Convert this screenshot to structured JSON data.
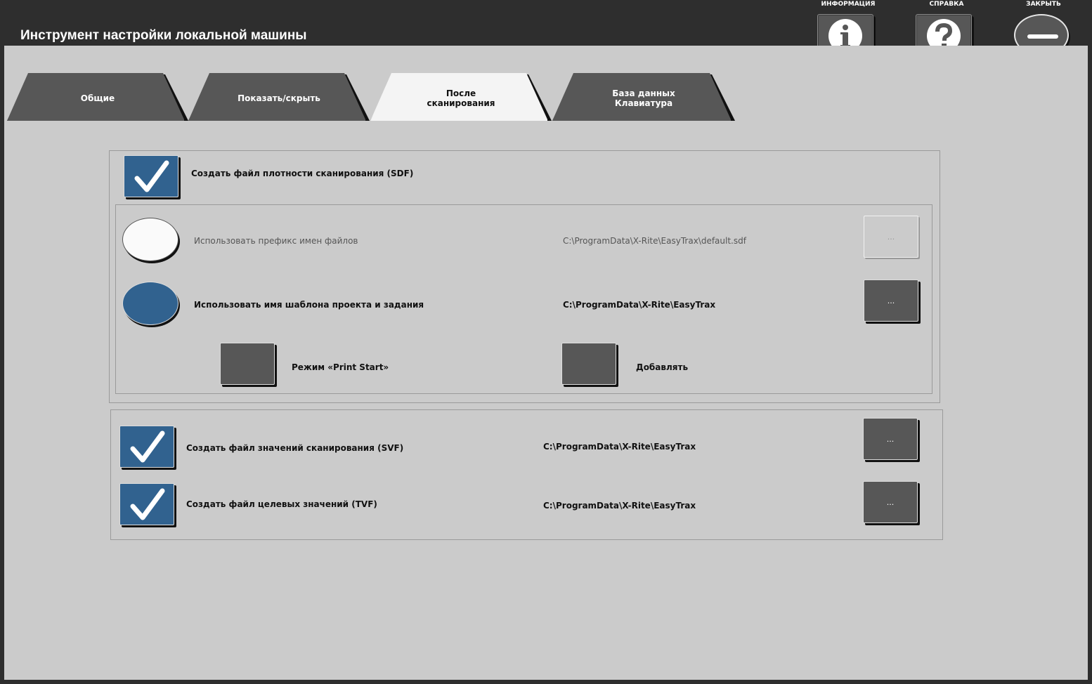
{
  "header": {
    "title": "Инструмент настройки локальной машины",
    "info_label": "ИНФОРМАЦИЯ",
    "help_label": "СПРАВКА",
    "close_label": "ЗАКРЫТЬ"
  },
  "tabs": [
    {
      "label": "Общие"
    },
    {
      "label": "Показать/скрыть"
    },
    {
      "label": "После\nсканирования"
    },
    {
      "label": "База данных\nКлавиатура"
    }
  ],
  "active_tab": "После\nсканирования",
  "sdf": {
    "label": "Создать файл плотности сканирования (SDF)",
    "checked": true,
    "prefix_option": {
      "label": "Использовать префикс имен файлов",
      "path": "C:\\ProgramData\\X-Rite\\EasyTrax\\default.sdf",
      "selected": false,
      "browse": "..."
    },
    "template_option": {
      "label": "Использовать имя шаблона проекта и задания",
      "path": "C:\\ProgramData\\X-Rite\\EasyTrax",
      "selected": true,
      "browse": "..."
    },
    "print_start": {
      "label": "Режим «Print Start»",
      "checked": false
    },
    "append": {
      "label": "Добавлять",
      "checked": false
    }
  },
  "svf": {
    "label": "Создать файл значений сканирования (SVF)",
    "path": "C:\\ProgramData\\X-Rite\\EasyTrax",
    "checked": true,
    "browse": "..."
  },
  "tvf": {
    "label": "Создать файл целевых значений (TVF)",
    "path": "C:\\ProgramData\\X-Rite\\EasyTrax",
    "checked": true,
    "browse": "..."
  },
  "colors": {
    "accent": "#31628f",
    "button": "#575757",
    "panel": "#cbcbcb",
    "frame": "#2e2e2e"
  }
}
